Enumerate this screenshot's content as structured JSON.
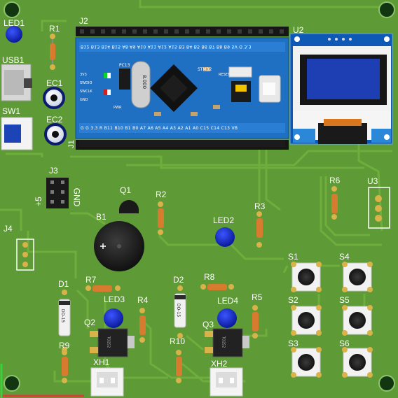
{
  "board": {
    "colors": {
      "pcb": "#5e9a36",
      "trace": "#6fae3c",
      "silk": "#ffffff",
      "mcu_blue": "#1f6fc2",
      "led_blue": "#1a2fd6",
      "pin_black": "#1a1a1a",
      "pad_gold": "#d9b24a",
      "resistor": "#d77b2f"
    },
    "components": {
      "led1": "LED1",
      "usb1": "USB1",
      "sw1": "SW1",
      "r1": "R1",
      "j2": "J2",
      "ec1": "EC1",
      "ec2": "EC2",
      "j1": "J1",
      "u2": "U2",
      "j3": "J3",
      "j3_plus": "+5",
      "j3_gnd": "GND",
      "q1": "Q1",
      "r2": "R2",
      "r6": "R6",
      "u3": "U3",
      "b1": "B1",
      "led2": "LED2",
      "r3": "R3",
      "j4": "J4",
      "s1": "S1",
      "s4": "S4",
      "d1": "D1",
      "r7": "R7",
      "led3": "LED3",
      "r4": "R4",
      "d2": "D2",
      "r8": "R8",
      "led4": "LED4",
      "r5": "R5",
      "s2": "S2",
      "s5": "S5",
      "q2": "Q2",
      "q3": "Q3",
      "r9": "R9",
      "r10": "R10",
      "s3": "S3",
      "s6": "S6",
      "xh1": "XH1",
      "xh2": "XH2"
    },
    "mcu": {
      "chip": "STM32",
      "crystal": "8.000",
      "reset": "RESET",
      "pc13": "PC13",
      "pwr": "PWR",
      "v3": "3V3",
      "swclk": "SWCLK",
      "swdio": "SWDIO",
      "gnd": "GND",
      "top_pins": "B12 B13 B14 B15 A8 A9 A10 A11 A12 A15 B3 B4 B5 B6 B7 B8 B9 5V G 3.3",
      "bottom_pins": "G G 3.3 R B11 B10 B1 B0 A7 A6 A5 A4 A3 A2 A1 A0 C15 C14 C13 VB"
    },
    "diode_text": "DO-15",
    "transistor_text": "TO252"
  }
}
